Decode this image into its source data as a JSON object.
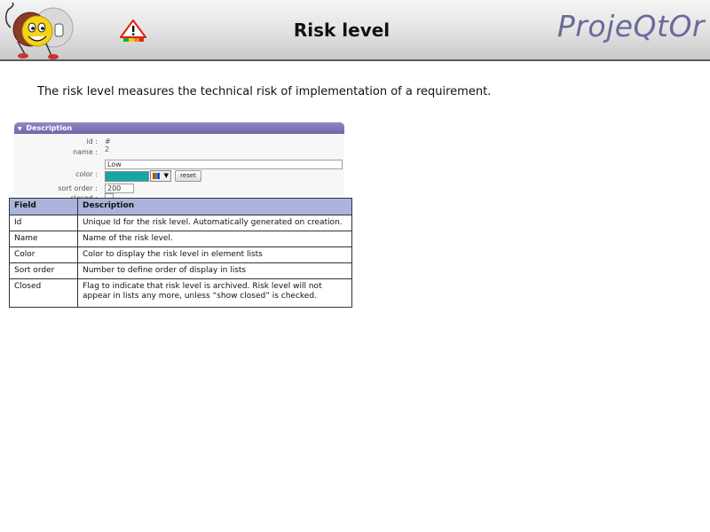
{
  "header": {
    "title": "Risk level",
    "brand": "ProjeQtOr",
    "logo_icon": "smiley-mascot-logo-icon",
    "page_icon": "warning-risk-icon"
  },
  "intro": "The risk level measures the technical risk of implementation of a requirement.",
  "form": {
    "section_title": "Description",
    "id_label": "id :",
    "id_value": "# 2",
    "name_label": "name :",
    "name_value": "Low",
    "color_label": "color :",
    "color_value": "#15a7a3",
    "reset_label": "reset",
    "sort_order_label": "sort order :",
    "sort_order_value": "200",
    "closed_label": "closed :"
  },
  "table": {
    "headers": [
      "Field",
      "Description"
    ],
    "rows": [
      {
        "field": "Id",
        "description": "Unique Id for the risk level. Automatically generated on creation."
      },
      {
        "field": "Name",
        "description": "Name of the risk level."
      },
      {
        "field": "Color",
        "description": "Color to display the risk level in element lists"
      },
      {
        "field": "Sort order",
        "description": "Number to define order of display in lists"
      },
      {
        "field": "Closed",
        "description": "Flag to indicate that risk level is archived. Risk level will not appear in lists any more, unless “show closed” is checked."
      }
    ]
  }
}
